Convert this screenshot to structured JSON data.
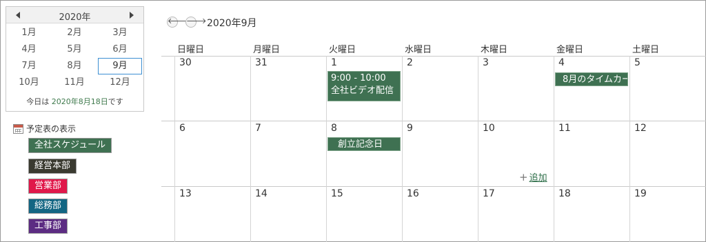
{
  "mini_calendar": {
    "year_label": "2020年",
    "months": [
      "1月",
      "2月",
      "3月",
      "4月",
      "5月",
      "6月",
      "7月",
      "8月",
      "9月",
      "10月",
      "11月",
      "12月"
    ],
    "selected_month": "9月",
    "today_prefix": "今日は",
    "today_date": "2020年8月18日",
    "today_suffix": "です"
  },
  "legend": {
    "title": "予定表の表示",
    "items": [
      {
        "label": "全社スケジュール",
        "color": "#3f7152"
      },
      {
        "label": "経営本部",
        "color": "#3a3a30"
      },
      {
        "label": "営業部",
        "color": "#e0184a"
      },
      {
        "label": "総務部",
        "color": "#136683"
      },
      {
        "label": "工事部",
        "color": "#5c2c82"
      }
    ]
  },
  "header": {
    "title": "2020年9月",
    "prev_icon": "left-arrow",
    "next_icon": "right-arrow"
  },
  "weekdays": [
    "日曜日",
    "月曜日",
    "火曜日",
    "水曜日",
    "木曜日",
    "金曜日",
    "土曜日"
  ],
  "weeks": [
    [
      "30",
      "31",
      "1",
      "2",
      "3",
      "4",
      "5"
    ],
    [
      "6",
      "7",
      "8",
      "9",
      "10",
      "11",
      "12"
    ],
    [
      "13",
      "14",
      "15",
      "16",
      "17",
      "18",
      "19"
    ]
  ],
  "events": {
    "video": {
      "time": "9:00 - 10:00",
      "title": "全社ビデオ配信"
    },
    "timeca": {
      "title": "8月のタイムカー"
    },
    "founding": {
      "title": "創立記念日"
    }
  },
  "add_link": {
    "label": "追加",
    "icon": "plus"
  }
}
